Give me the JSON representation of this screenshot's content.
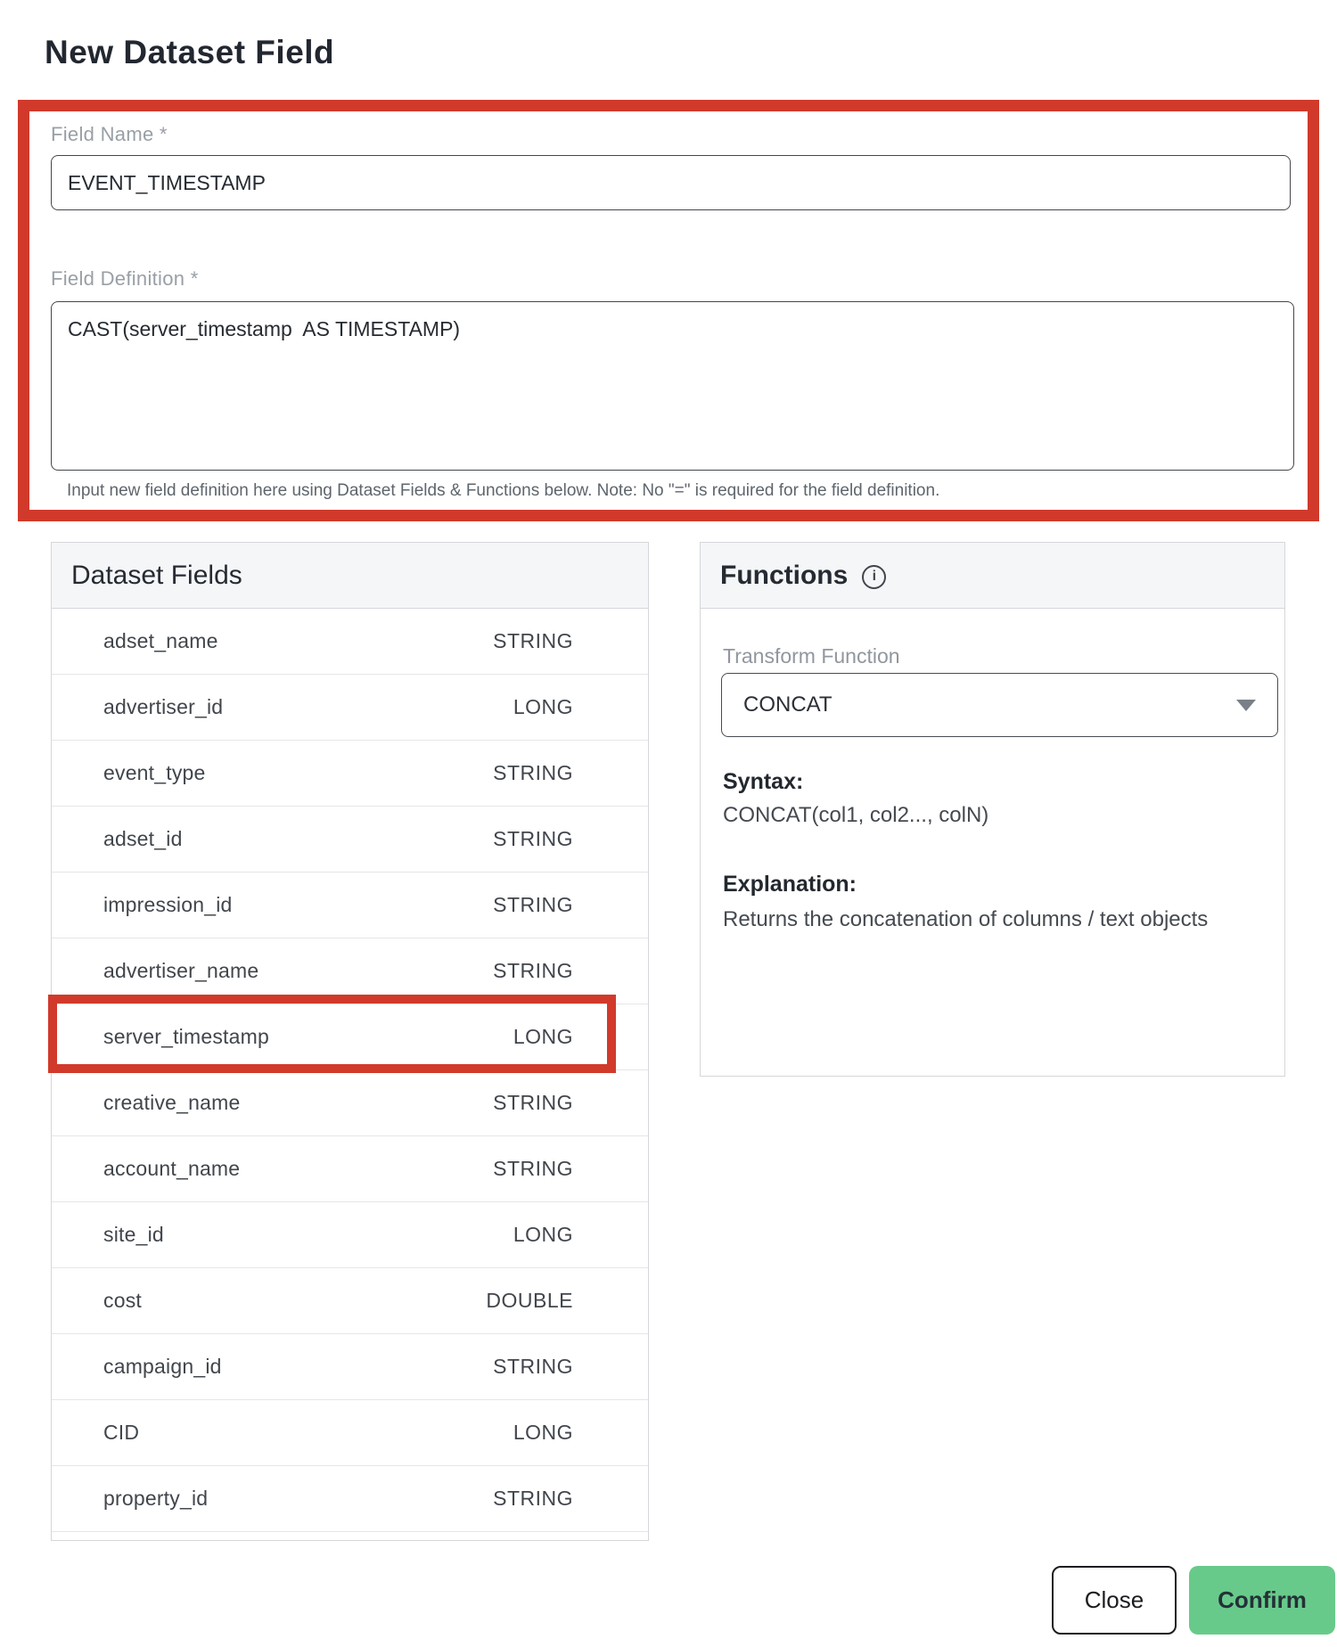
{
  "page": {
    "title": "New Dataset Field"
  },
  "form": {
    "field_name": {
      "label": "Field Name *",
      "value": "EVENT_TIMESTAMP"
    },
    "field_definition": {
      "label": "Field Definition *",
      "value": "CAST(server_timestamp  AS TIMESTAMP)",
      "help": "Input new field definition here using Dataset Fields & Functions below. Note: No \"=\" is required for the field definition."
    }
  },
  "dataset_fields": {
    "title": "Dataset Fields",
    "highlighted_row": "server_timestamp",
    "rows": [
      {
        "name": "adset_name",
        "type": "STRING"
      },
      {
        "name": "advertiser_id",
        "type": "LONG"
      },
      {
        "name": "event_type",
        "type": "STRING"
      },
      {
        "name": "adset_id",
        "type": "STRING"
      },
      {
        "name": "impression_id",
        "type": "STRING"
      },
      {
        "name": "advertiser_name",
        "type": "STRING"
      },
      {
        "name": "server_timestamp",
        "type": "LONG"
      },
      {
        "name": "creative_name",
        "type": "STRING"
      },
      {
        "name": "account_name",
        "type": "STRING"
      },
      {
        "name": "site_id",
        "type": "LONG"
      },
      {
        "name": "cost",
        "type": "DOUBLE"
      },
      {
        "name": "campaign_id",
        "type": "STRING"
      },
      {
        "name": "CID",
        "type": "LONG"
      },
      {
        "name": "property_id",
        "type": "STRING"
      }
    ]
  },
  "functions": {
    "title": "Functions",
    "info_icon": "i",
    "transform_function": {
      "label": "Transform Function",
      "selected": "CONCAT"
    },
    "syntax_heading": "Syntax:",
    "syntax": "CONCAT(col1, col2..., colN)",
    "explanation_heading": "Explanation:",
    "explanation": "Returns the concatenation of columns / text objects"
  },
  "actions": {
    "close": "Close",
    "confirm": "Confirm"
  },
  "colors": {
    "annotation_red": "#d13a2b",
    "confirm_green": "#68ca8a",
    "panel_header_bg": "#f5f6f8",
    "panel_border": "#d5d7da",
    "label_gray": "#999fa5"
  }
}
